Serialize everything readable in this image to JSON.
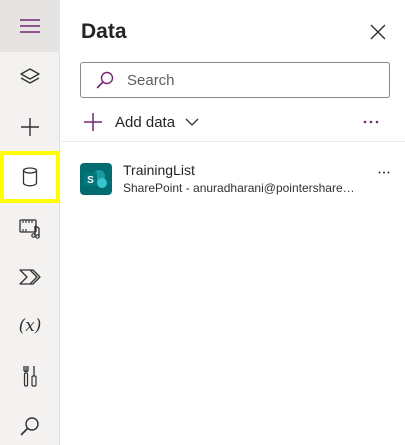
{
  "rail": {
    "items": [
      {
        "icon": "hamburger-icon"
      },
      {
        "icon": "layers-icon"
      },
      {
        "icon": "plus-icon"
      },
      {
        "icon": "database-icon",
        "selected": true
      },
      {
        "icon": "media-icon"
      },
      {
        "icon": "power-automate-icon"
      },
      {
        "icon": "variables-icon",
        "glyph": "(x)"
      },
      {
        "icon": "tools-icon"
      },
      {
        "icon": "search-icon"
      }
    ],
    "highlight_color": "#ffff00"
  },
  "panel": {
    "title": "Data",
    "search": {
      "placeholder": "Search",
      "value": ""
    },
    "add_data_label": "Add data",
    "sources": [
      {
        "name": "TrainingList",
        "subtitle": "SharePoint - anuradharani@pointersharepoint.com",
        "icon": "sharepoint-icon"
      }
    ]
  },
  "colors": {
    "accent": "#742774",
    "sharepoint": "#036c70"
  }
}
